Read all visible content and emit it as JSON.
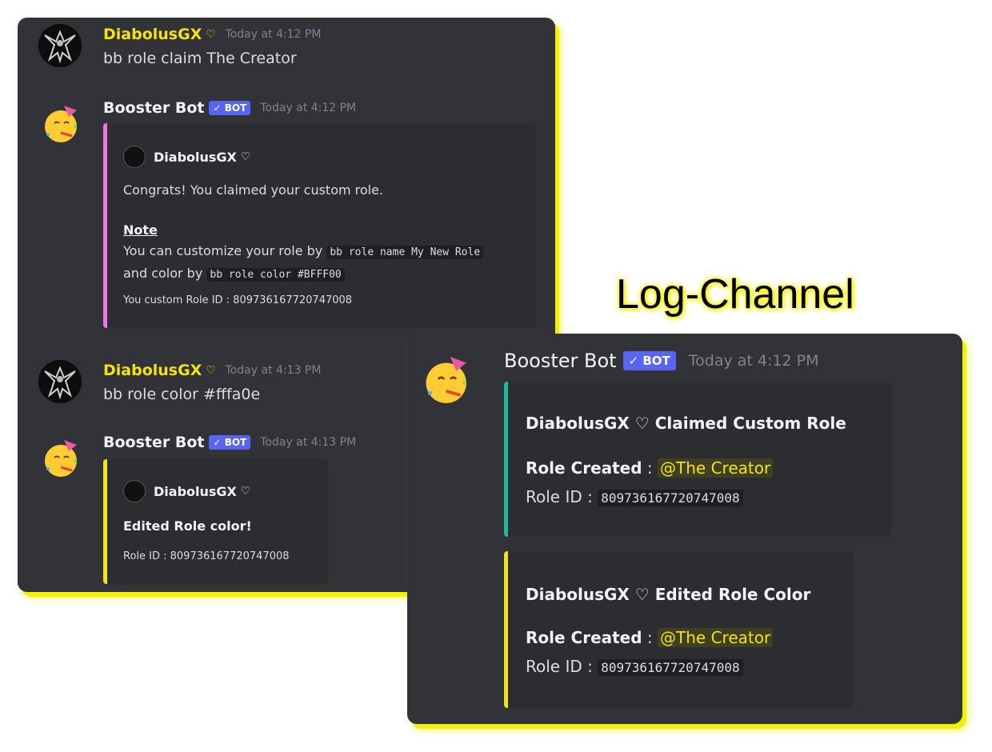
{
  "log_label": "Log-Channel",
  "colors": {
    "panel_bg": "#313338",
    "embed_bg": "#2b2d31",
    "user_yellow": "#f5e311",
    "bot_badge": "#5865f2",
    "pink_bar": "#ee76e6",
    "teal_bar": "#1abc9c",
    "yellow_bar": "#f5e311",
    "highlight": "#f2f200"
  },
  "left": {
    "messages": [
      {
        "user": "DiabolusGX",
        "time": "Today at 4:12 PM",
        "text": "bb role claim The Creator"
      },
      {
        "user": "Booster Bot",
        "badge": "✓ BOT",
        "time": "Today at 4:12 PM",
        "embed": {
          "author": "DiabolusGX",
          "line1": "Congrats! You claimed your custom role.",
          "note_title": "Note",
          "note_text_a": "You can customize your role by",
          "note_code_a": "bb role name My New Role",
          "note_text_b": "and color by",
          "note_code_b": "bb role color #BFFF00",
          "footer": "You custom Role ID : 809736167720747008"
        }
      },
      {
        "user": "DiabolusGX",
        "time": "Today at 4:13 PM",
        "text": "bb role color #fffa0e"
      },
      {
        "user": "Booster Bot",
        "badge": "✓ BOT",
        "time": "Today at 4:13 PM",
        "embed": {
          "author": "DiabolusGX",
          "title": "Edited Role color!",
          "footer": "Role ID : 809736167720747008"
        }
      }
    ]
  },
  "right": {
    "user": "Booster Bot",
    "badge": "✓ BOT",
    "time": "Today at 4:12 PM",
    "embeds": [
      {
        "title": "DiabolusGX ♡ Claimed Custom Role",
        "role_label": "Role Created",
        "sep": " : ",
        "mention": "@The Creator",
        "id_label": "Role ID : ",
        "id_value": "809736167720747008"
      },
      {
        "title": "DiabolusGX ♡ Edited Role Color",
        "role_label": "Role Created",
        "sep": " : ",
        "mention": "@The Creator",
        "id_label": "Role ID : ",
        "id_value": "809736167720747008"
      }
    ]
  }
}
